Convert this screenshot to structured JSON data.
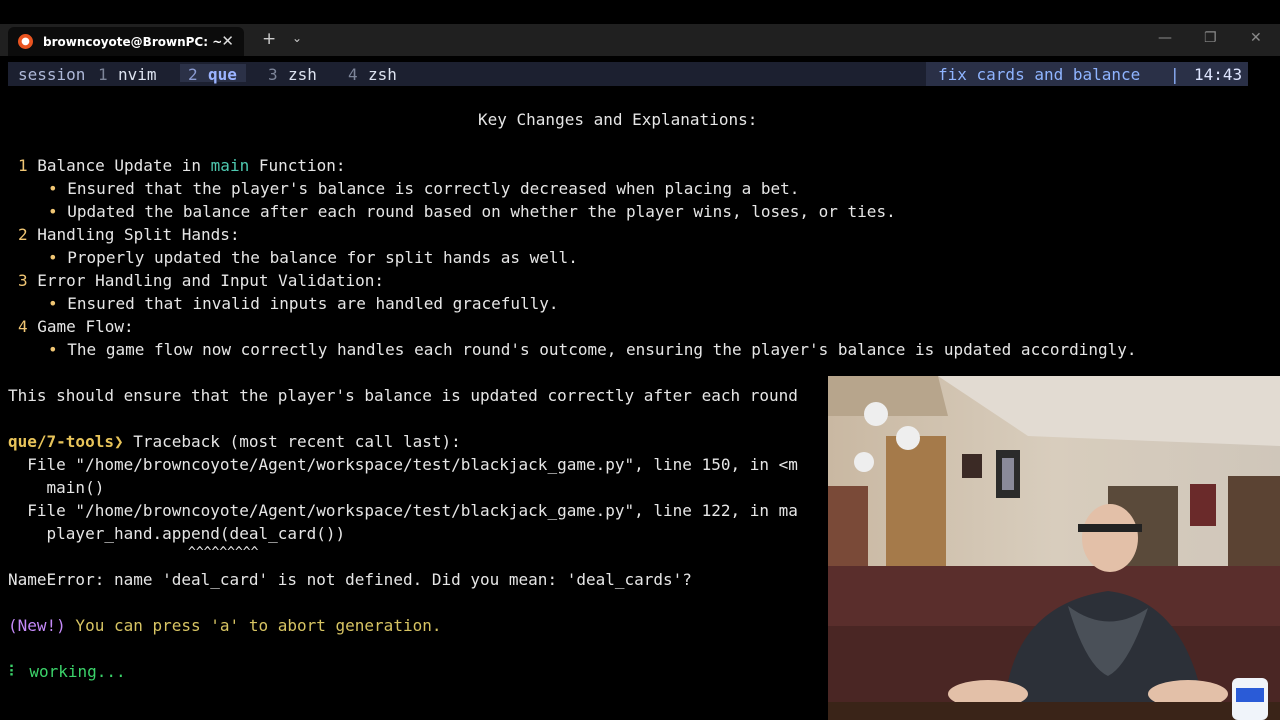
{
  "window": {
    "tab_title": "browncoyote@BrownPC: ~",
    "tab_close": "✕",
    "new_tab": "+",
    "tab_dropdown": "⌄",
    "minimize": "—",
    "restore": "❐",
    "close": "✕"
  },
  "status": {
    "session_label": "session",
    "windows": [
      {
        "index": "1",
        "name": "nvim"
      },
      {
        "index": "2",
        "name": "que"
      },
      {
        "index": "3",
        "name": "zsh"
      },
      {
        "index": "4",
        "name": "zsh"
      }
    ],
    "title": "fix cards and balance",
    "separator": "|",
    "time": "14:43"
  },
  "output": {
    "heading": "Key Changes and Explanations:",
    "items": [
      {
        "num": "1",
        "pre": "Balance Update in ",
        "code": "main",
        "post": " Function:",
        "bullets": [
          "Ensured that the player's balance is correctly decreased when placing a bet.",
          "Updated the balance after each round based on whether the player wins, loses, or ties."
        ]
      },
      {
        "num": "2",
        "title": "Handling Split Hands:",
        "bullets": [
          "Properly updated the balance for split hands as well."
        ]
      },
      {
        "num": "3",
        "title": "Error Handling and Input Validation:",
        "bullets": [
          "Ensured that invalid inputs are handled gracefully."
        ]
      },
      {
        "num": "4",
        "title": "Game Flow:",
        "bullets": [
          "The game flow now correctly handles each round's outcome, ensuring the player's balance is updated accordingly."
        ]
      }
    ],
    "summary": "This should ensure that the player's balance is updated correctly after each round"
  },
  "traceback": {
    "prompt": "que/7-tools❯",
    "header": " Traceback (most recent call last):",
    "lines": [
      "  File \"/home/browncoyote/Agent/workspace/test/blackjack_game.py\", line 150, in <m",
      "    main()",
      "  File \"/home/browncoyote/Agent/workspace/test/blackjack_game.py\", line 122, in ma",
      "    player_hand.append(deal_card())",
      "                       ^^^^^^^^^"
    ],
    "error": "NameError: name 'deal_card' is not defined. Did you mean: 'deal_cards'?"
  },
  "notice": {
    "tag": "(New!)",
    "text": " You can press 'a' to abort generation."
  },
  "spinner": {
    "glyph": "⠇",
    "text": " working..."
  },
  "webcam": {
    "icon": "webcam-person-icon"
  },
  "colors": {
    "background": "#000000",
    "titlebar": "#202020",
    "status_bar": "#1c2030",
    "bullet_yellow": "#f0c674",
    "code_green": "#4ec9b0",
    "prompt_yellow": "#e8c45a",
    "notice_purple": "#c58af9",
    "notice_yellow": "#d7c463",
    "working_green": "#3bd36a"
  }
}
